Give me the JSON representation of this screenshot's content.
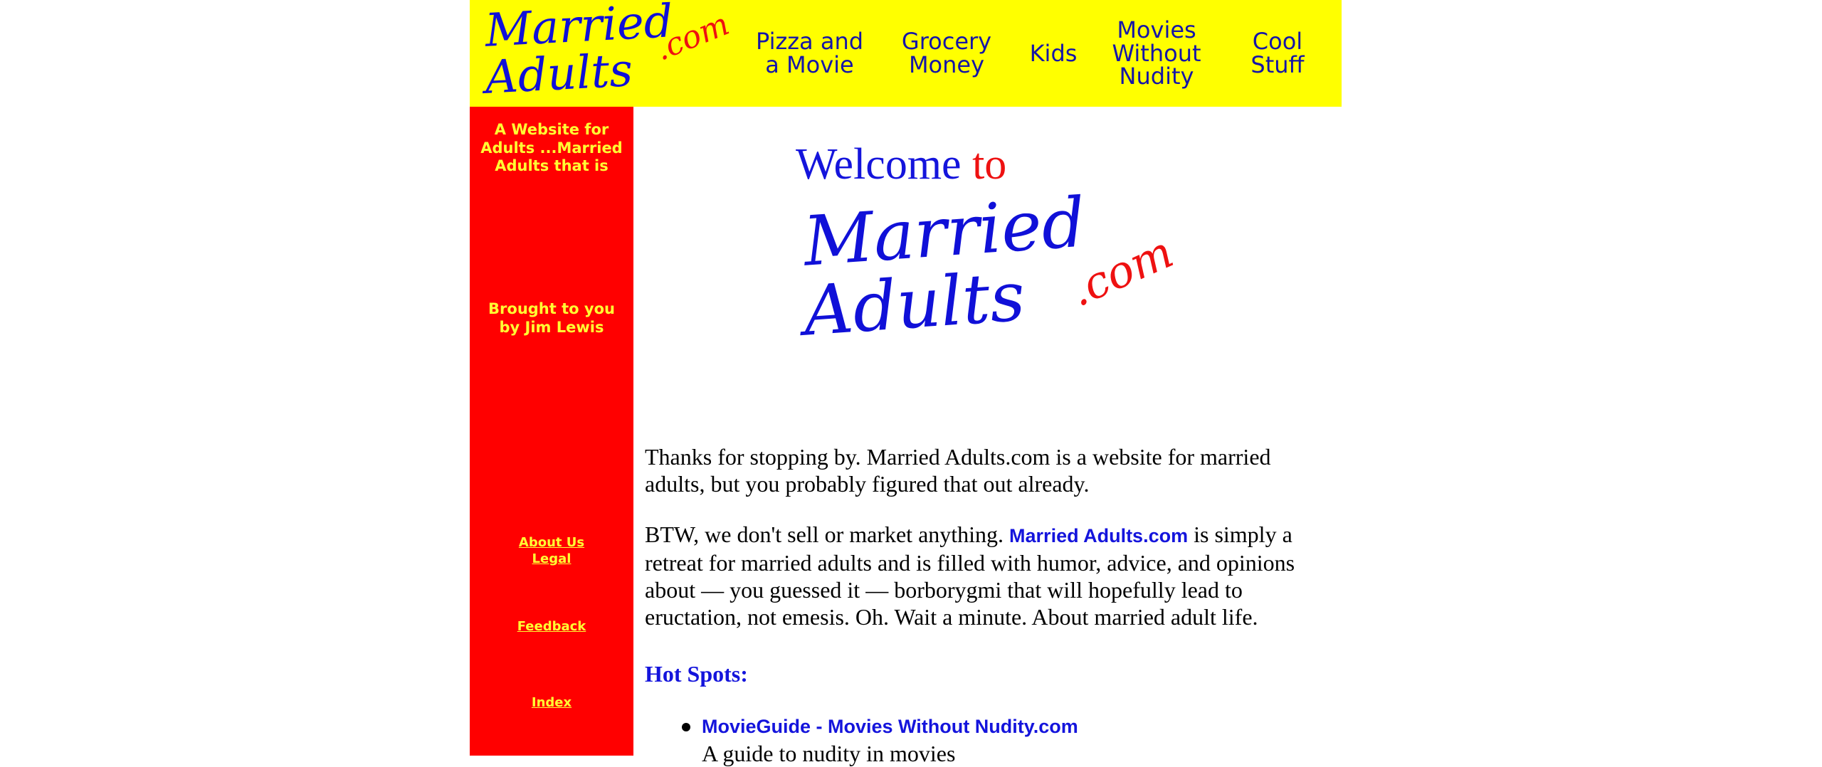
{
  "brand": {
    "logo_line1": "Married",
    "logo_line2": "Adults",
    "logo_dotcom": ".com",
    "primary_color": "#1414dc",
    "accent_color": "#ee1111",
    "header_bg": "#ffff00",
    "sidebar_bg": "#ff0000"
  },
  "nav": {
    "items": [
      {
        "label": "Pizza and\na Movie"
      },
      {
        "label": "Grocery\nMoney"
      },
      {
        "label": "Kids"
      },
      {
        "label": "Movies\nWithout\nNudity"
      },
      {
        "label": "Cool\nStuff"
      }
    ]
  },
  "sidebar": {
    "tagline": "A Website for\nAdults ...Married\nAdults that is",
    "byline": "Brought to you\nby Jim Lewis",
    "links": {
      "about": "About Us",
      "legal": "Legal",
      "feedback": "Feedback",
      "index": "Index"
    }
  },
  "main": {
    "welcome_word1": "Welcome",
    "welcome_word2": "to",
    "para1": "Thanks for stopping by. Married Adults.com is a website for married adults, but you probably figured that out already.",
    "para2_start": "BTW, we don't sell or market anything. ",
    "para2_brand": "Married Adults.com",
    "para2_end": " is simply a retreat for married adults and is filled with humor, advice, and opinions about — you guessed it — borborygmi that will hopefully lead to eructation, not emesis. Oh. Wait a minute. About married adult life.",
    "hotspots_heading": "Hot Spots:",
    "hotspots": [
      {
        "title": "MovieGuide - Movies Without Nudity.com",
        "description": "A guide to nudity in movies"
      }
    ]
  }
}
